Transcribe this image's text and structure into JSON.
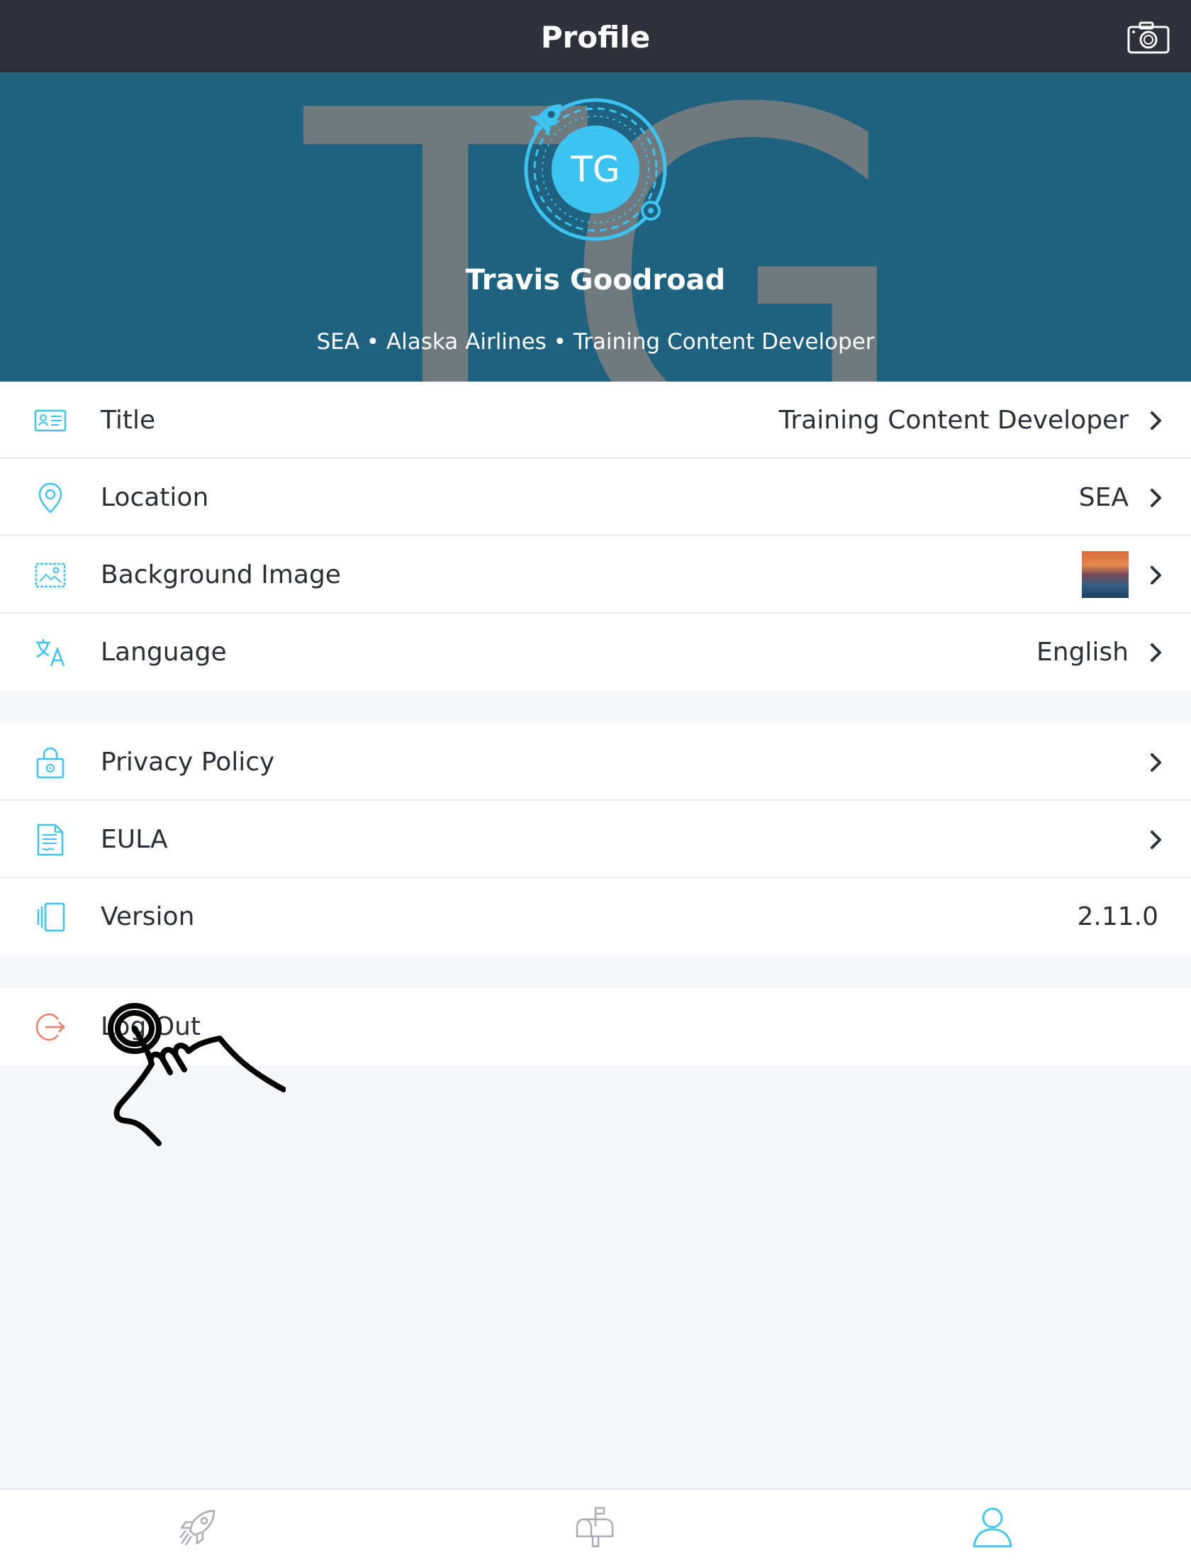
{
  "navbar": {
    "title": "Profile",
    "camera_icon": "camera-icon"
  },
  "hero": {
    "watermark": "TG",
    "initials": "TG",
    "name": "Travis Goodroad",
    "subtitle": "SEA • Alaska Airlines • Training Content Developer",
    "accent": "#3cc3f0",
    "background": "#1e627f"
  },
  "profile_rows": [
    {
      "label": "Title",
      "value": "Training Content Developer",
      "icon": "id-card-icon"
    },
    {
      "label": "Location",
      "value": "SEA",
      "icon": "map-pin-icon"
    },
    {
      "label": "Background Image",
      "value": "",
      "icon": "image-icon"
    },
    {
      "label": "Language",
      "value": "English",
      "icon": "translate-icon"
    }
  ],
  "info_rows": [
    {
      "label": "Privacy Policy",
      "icon": "lock-icon"
    },
    {
      "label": "EULA",
      "icon": "document-icon"
    },
    {
      "label": "Version",
      "value": "2.11.0",
      "icon": "devices-icon"
    }
  ],
  "logout": {
    "label": "Log Out",
    "icon": "logout-icon",
    "color": "#f07b6c"
  },
  "tabbar": {
    "tabs": [
      {
        "name": "rocket-icon",
        "active": false
      },
      {
        "name": "mailbox-icon",
        "active": false
      },
      {
        "name": "user-icon",
        "active": true
      }
    ],
    "active_color": "#3cc3f0",
    "inactive_color": "#a9adb3"
  }
}
